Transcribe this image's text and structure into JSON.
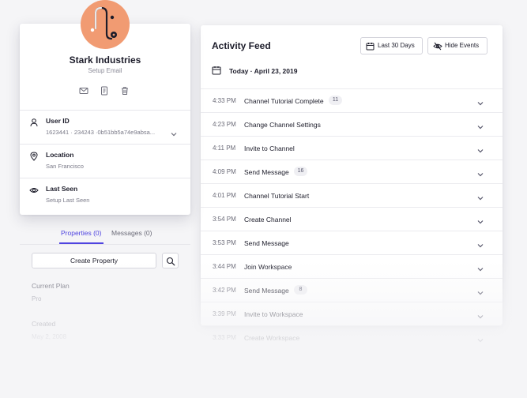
{
  "profile": {
    "company_name": "Stark Industries",
    "setup_email": "Setup Email",
    "accent_color": "#f19b72",
    "action_icons": [
      "email-icon",
      "document-icon",
      "trash-icon"
    ]
  },
  "attributes": [
    {
      "label": "User ID",
      "value": "1623441 · 234243 ·0b51bb5a74e9absa...",
      "icon": "user-icon"
    },
    {
      "label": "Location",
      "value": "San Francisco",
      "icon": "location-pin-icon"
    },
    {
      "label": "Last Seen",
      "value": "Setup Last Seen",
      "icon": "eye-icon"
    }
  ],
  "tabs": [
    {
      "label": "Properties (0)",
      "active": true
    },
    {
      "label": "Messages (0)",
      "active": false
    }
  ],
  "create_property_label": "Create Property",
  "properties": [
    {
      "label": "Current Plan",
      "value": "Pro"
    },
    {
      "label": "Created",
      "value": "May 2, 2008"
    }
  ],
  "feed": {
    "title": "Activity Feed",
    "range_button": "Last 30 Days",
    "hide_events_button": "Hide Events",
    "today_label": "Today · April 23, 2019",
    "events": [
      {
        "time": "4:33 PM",
        "name": "Channel Tutorial Complete",
        "count": "11"
      },
      {
        "time": "4:23 PM",
        "name": "Change Channel Settings",
        "count": ""
      },
      {
        "time": "4:11 PM",
        "name": "Invite to Channel",
        "count": ""
      },
      {
        "time": "4:09 PM",
        "name": "Send Message",
        "count": "16"
      },
      {
        "time": "4:01 PM",
        "name": "Channel Tutorial Start",
        "count": ""
      },
      {
        "time": "3:54 PM",
        "name": "Create Channel",
        "count": ""
      },
      {
        "time": "3:53 PM",
        "name": "Send Message",
        "count": ""
      },
      {
        "time": "3:44 PM",
        "name": "Join Workspace",
        "count": ""
      },
      {
        "time": "3:42 PM",
        "name": "Send Message",
        "count": "8"
      },
      {
        "time": "3:39 PM",
        "name": "Invite to Workspace",
        "count": ""
      },
      {
        "time": "3:33 PM",
        "name": "Create Workspace",
        "count": ""
      }
    ]
  },
  "colors": {
    "primary": "#4f44e0",
    "background": "#f5f5f7"
  }
}
